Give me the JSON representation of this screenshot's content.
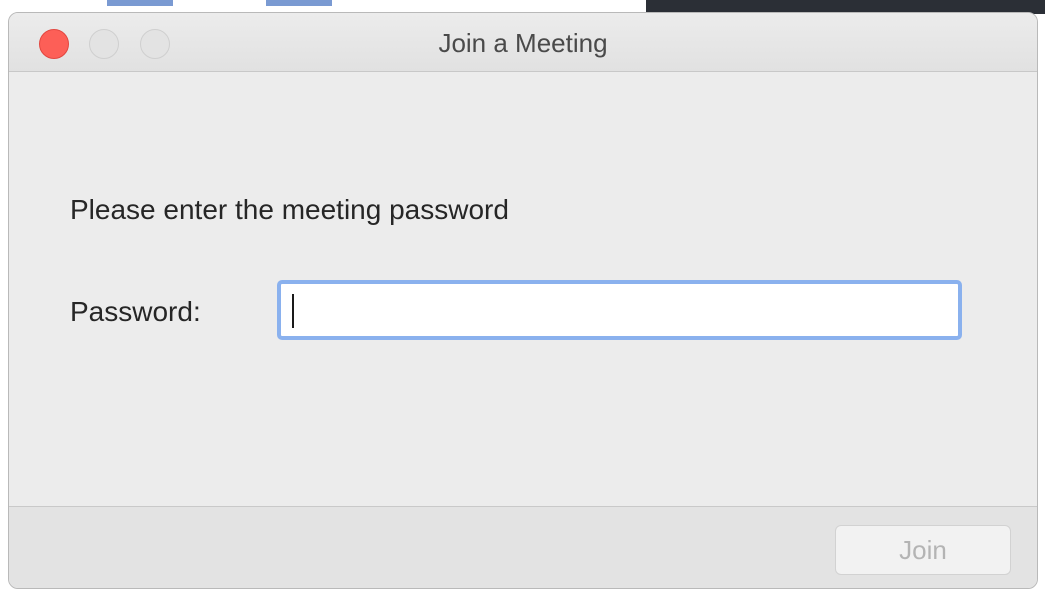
{
  "window": {
    "title": "Join a Meeting"
  },
  "dialog": {
    "prompt": "Please enter the meeting password",
    "password_label": "Password:",
    "password_value": "",
    "password_placeholder": ""
  },
  "footer": {
    "join_label": "Join"
  },
  "colors": {
    "close": "#fd5f57",
    "focus_ring": "#8ab1ee",
    "disabled_text": "#b4b4b4"
  }
}
